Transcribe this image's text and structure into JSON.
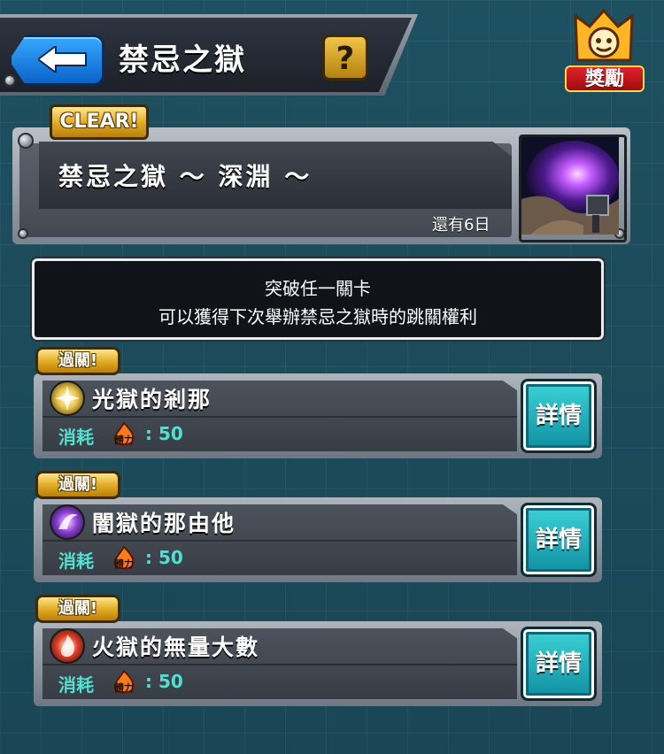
{
  "header": {
    "title": "禁忌之獄",
    "help_label": "?",
    "reward_label": "獎勵"
  },
  "event": {
    "clear_badge": "CLEAR!",
    "title": "禁忌之獄 ～ 深淵 ～",
    "remaining": "還有6日"
  },
  "description": {
    "line1": "突破任一關卡",
    "line2": "可以獲得下次舉辦禁忌之獄時的跳關權利"
  },
  "stages": [
    {
      "badge": "過關!",
      "name": "光獄的剎那",
      "cost_label": "消耗",
      "stamina_label": "體力",
      "cost_value": ": 50",
      "detail_label": "詳情",
      "icon": "light-element-icon",
      "icon_color": "#e8c24a"
    },
    {
      "badge": "過關!",
      "name": "闇獄的那由他",
      "cost_label": "消耗",
      "stamina_label": "體力",
      "cost_value": ": 50",
      "detail_label": "詳情",
      "icon": "dark-element-icon",
      "icon_color": "#8a3fd1"
    },
    {
      "badge": "過關!",
      "name": "火獄的無量大數",
      "cost_label": "消耗",
      "stamina_label": "體力",
      "cost_value": ": 50",
      "detail_label": "詳情",
      "icon": "fire-element-icon",
      "icon_color": "#e0402a"
    }
  ],
  "colors": {
    "accent_cyan": "#54e0d0",
    "badge_gold": "#e0a81f",
    "back_blue": "#0a63c9"
  }
}
